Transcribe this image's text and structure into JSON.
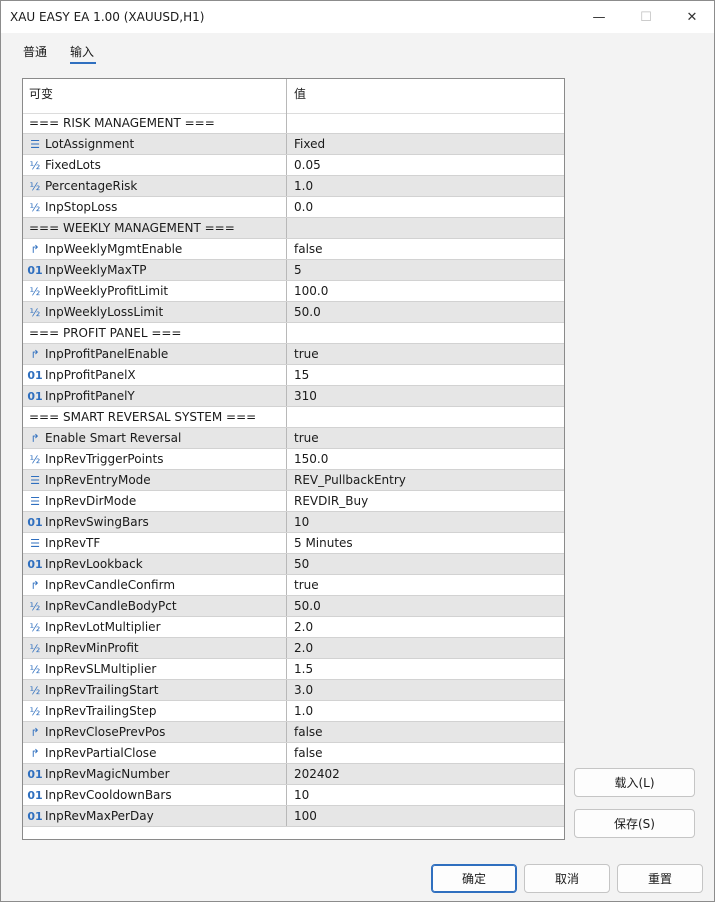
{
  "window": {
    "title": "XAU EASY EA 1.00 (XAUUSD,H1)",
    "controls": {
      "minimize": "—",
      "maximize": "☐",
      "close": "✕"
    }
  },
  "tabs": [
    {
      "label": "普通"
    },
    {
      "label": "输入",
      "active": true
    }
  ],
  "grid": {
    "headers": {
      "variable": "可变",
      "value": "值"
    },
    "rows": [
      {
        "type": "section",
        "name": "=== RISK MANAGEMENT ===",
        "value": ""
      },
      {
        "type": "enum",
        "icon": "enum-icon",
        "name": "LotAssignment",
        "value": "Fixed"
      },
      {
        "type": "double",
        "icon": "double-icon",
        "name": "FixedLots",
        "value": "0.05"
      },
      {
        "type": "double",
        "icon": "double-icon",
        "name": "PercentageRisk",
        "value": "1.0"
      },
      {
        "type": "double",
        "icon": "double-icon",
        "name": "InpStopLoss",
        "value": "0.0"
      },
      {
        "type": "section",
        "name": "=== WEEKLY MANAGEMENT ===",
        "value": ""
      },
      {
        "type": "bool",
        "icon": "bool-icon",
        "name": "InpWeeklyMgmtEnable",
        "value": "false"
      },
      {
        "type": "int",
        "icon": "int-icon",
        "name": "InpWeeklyMaxTP",
        "value": "5"
      },
      {
        "type": "double",
        "icon": "double-icon",
        "name": "InpWeeklyProfitLimit",
        "value": "100.0"
      },
      {
        "type": "double",
        "icon": "double-icon",
        "name": "InpWeeklyLossLimit",
        "value": "50.0"
      },
      {
        "type": "section",
        "name": "=== PROFIT PANEL ===",
        "value": ""
      },
      {
        "type": "bool",
        "icon": "bool-icon",
        "name": "InpProfitPanelEnable",
        "value": "true"
      },
      {
        "type": "int",
        "icon": "int-icon",
        "name": "InpProfitPanelX",
        "value": "15"
      },
      {
        "type": "int",
        "icon": "int-icon",
        "name": "InpProfitPanelY",
        "value": "310"
      },
      {
        "type": "section",
        "name": "=== SMART REVERSAL SYSTEM ===",
        "value": ""
      },
      {
        "type": "bool",
        "icon": "bool-icon",
        "name": "Enable Smart Reversal",
        "value": "true"
      },
      {
        "type": "double",
        "icon": "double-icon",
        "name": "InpRevTriggerPoints",
        "value": "150.0"
      },
      {
        "type": "enum",
        "icon": "enum-icon",
        "name": "InpRevEntryMode",
        "value": "REV_PullbackEntry"
      },
      {
        "type": "enum",
        "icon": "enum-icon",
        "name": "InpRevDirMode",
        "value": "REVDIR_Buy"
      },
      {
        "type": "int",
        "icon": "int-icon",
        "name": "InpRevSwingBars",
        "value": "10"
      },
      {
        "type": "enum",
        "icon": "enum-icon",
        "name": "InpRevTF",
        "value": "5 Minutes"
      },
      {
        "type": "int",
        "icon": "int-icon",
        "name": "InpRevLookback",
        "value": "50"
      },
      {
        "type": "bool",
        "icon": "bool-icon",
        "name": "InpRevCandleConfirm",
        "value": "true"
      },
      {
        "type": "double",
        "icon": "double-icon",
        "name": "InpRevCandleBodyPct",
        "value": "50.0"
      },
      {
        "type": "double",
        "icon": "double-icon",
        "name": "InpRevLotMultiplier",
        "value": "2.0"
      },
      {
        "type": "double",
        "icon": "double-icon",
        "name": "InpRevMinProfit",
        "value": "2.0"
      },
      {
        "type": "double",
        "icon": "double-icon",
        "name": "InpRevSLMultiplier",
        "value": "1.5"
      },
      {
        "type": "double",
        "icon": "double-icon",
        "name": "InpRevTrailingStart",
        "value": "3.0"
      },
      {
        "type": "double",
        "icon": "double-icon",
        "name": "InpRevTrailingStep",
        "value": "1.0"
      },
      {
        "type": "bool",
        "icon": "bool-icon",
        "name": "InpRevClosePrevPos",
        "value": "false"
      },
      {
        "type": "bool",
        "icon": "bool-icon",
        "name": "InpRevPartialClose",
        "value": "false"
      },
      {
        "type": "int",
        "icon": "int-icon",
        "name": "InpRevMagicNumber",
        "value": "202402"
      },
      {
        "type": "int",
        "icon": "int-icon",
        "name": "InpRevCooldownBars",
        "value": "10"
      },
      {
        "type": "int",
        "icon": "int-icon",
        "name": "InpRevMaxPerDay",
        "value": "100"
      }
    ]
  },
  "side_buttons": {
    "load": "载入(L)",
    "save": "保存(S)"
  },
  "footer_buttons": {
    "ok": "确定",
    "cancel": "取消",
    "reset": "重置"
  },
  "icon_glyphs": {
    "enum-icon": "☰",
    "double-icon": "½",
    "int-icon": "01",
    "bool-icon": "↱"
  },
  "colors": {
    "accent": "#2f6fbf",
    "row_alt": "#e6e6e6",
    "bool_icon": "#2a8a3a"
  }
}
